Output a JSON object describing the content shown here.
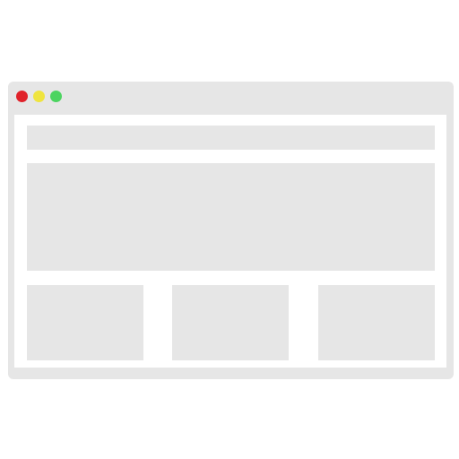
{
  "window": {
    "controls": [
      {
        "name": "close",
        "color": "#e0222a"
      },
      {
        "name": "minimize",
        "color": "#efe43e"
      },
      {
        "name": "maximize",
        "color": "#4cd460"
      }
    ]
  },
  "colors": {
    "chrome": "#e6e6e6",
    "viewport_background": "#ffffff",
    "placeholder_block": "#e6e6e6"
  },
  "wireframe": {
    "blocks": [
      "header-bar",
      "hero-banner",
      "card",
      "card",
      "card"
    ]
  }
}
